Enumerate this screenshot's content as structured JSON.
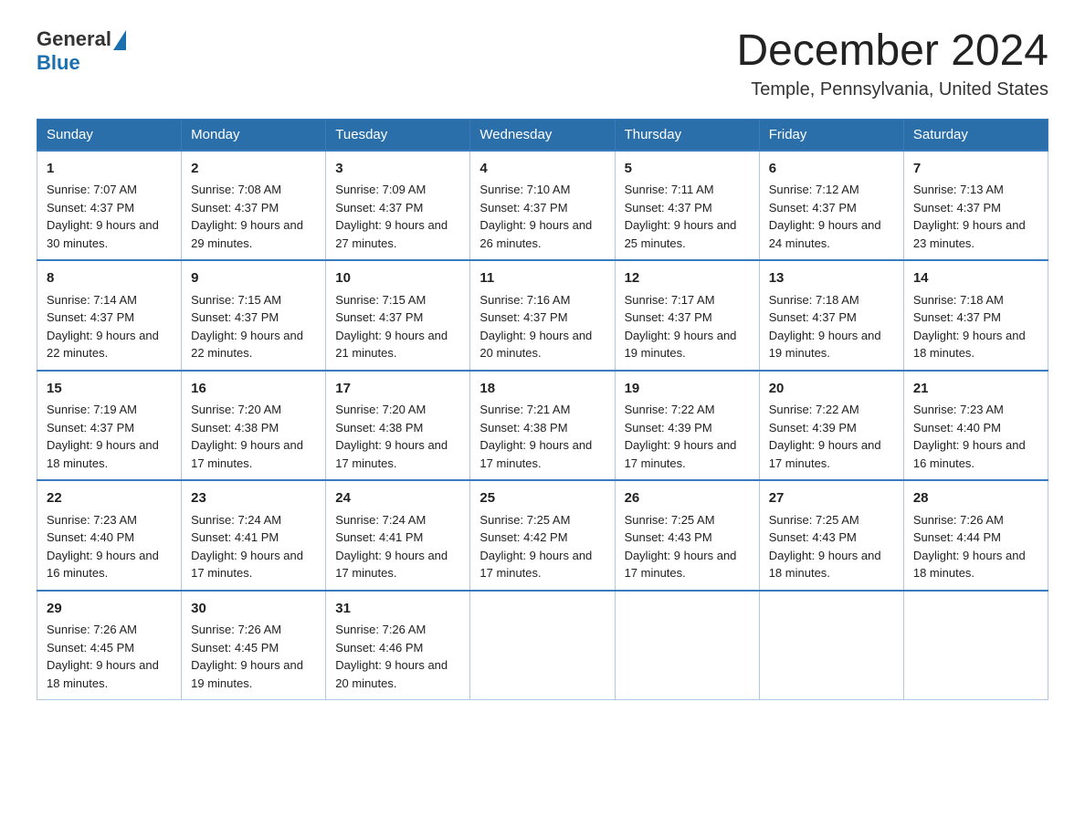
{
  "header": {
    "logo_general": "General",
    "logo_blue": "Blue",
    "month_title": "December 2024",
    "location": "Temple, Pennsylvania, United States"
  },
  "weekdays": [
    "Sunday",
    "Monday",
    "Tuesday",
    "Wednesday",
    "Thursday",
    "Friday",
    "Saturday"
  ],
  "weeks": [
    [
      {
        "day": "1",
        "sunrise": "7:07 AM",
        "sunset": "4:37 PM",
        "daylight": "9 hours and 30 minutes."
      },
      {
        "day": "2",
        "sunrise": "7:08 AM",
        "sunset": "4:37 PM",
        "daylight": "9 hours and 29 minutes."
      },
      {
        "day": "3",
        "sunrise": "7:09 AM",
        "sunset": "4:37 PM",
        "daylight": "9 hours and 27 minutes."
      },
      {
        "day": "4",
        "sunrise": "7:10 AM",
        "sunset": "4:37 PM",
        "daylight": "9 hours and 26 minutes."
      },
      {
        "day": "5",
        "sunrise": "7:11 AM",
        "sunset": "4:37 PM",
        "daylight": "9 hours and 25 minutes."
      },
      {
        "day": "6",
        "sunrise": "7:12 AM",
        "sunset": "4:37 PM",
        "daylight": "9 hours and 24 minutes."
      },
      {
        "day": "7",
        "sunrise": "7:13 AM",
        "sunset": "4:37 PM",
        "daylight": "9 hours and 23 minutes."
      }
    ],
    [
      {
        "day": "8",
        "sunrise": "7:14 AM",
        "sunset": "4:37 PM",
        "daylight": "9 hours and 22 minutes."
      },
      {
        "day": "9",
        "sunrise": "7:15 AM",
        "sunset": "4:37 PM",
        "daylight": "9 hours and 22 minutes."
      },
      {
        "day": "10",
        "sunrise": "7:15 AM",
        "sunset": "4:37 PM",
        "daylight": "9 hours and 21 minutes."
      },
      {
        "day": "11",
        "sunrise": "7:16 AM",
        "sunset": "4:37 PM",
        "daylight": "9 hours and 20 minutes."
      },
      {
        "day": "12",
        "sunrise": "7:17 AM",
        "sunset": "4:37 PM",
        "daylight": "9 hours and 19 minutes."
      },
      {
        "day": "13",
        "sunrise": "7:18 AM",
        "sunset": "4:37 PM",
        "daylight": "9 hours and 19 minutes."
      },
      {
        "day": "14",
        "sunrise": "7:18 AM",
        "sunset": "4:37 PM",
        "daylight": "9 hours and 18 minutes."
      }
    ],
    [
      {
        "day": "15",
        "sunrise": "7:19 AM",
        "sunset": "4:37 PM",
        "daylight": "9 hours and 18 minutes."
      },
      {
        "day": "16",
        "sunrise": "7:20 AM",
        "sunset": "4:38 PM",
        "daylight": "9 hours and 17 minutes."
      },
      {
        "day": "17",
        "sunrise": "7:20 AM",
        "sunset": "4:38 PM",
        "daylight": "9 hours and 17 minutes."
      },
      {
        "day": "18",
        "sunrise": "7:21 AM",
        "sunset": "4:38 PM",
        "daylight": "9 hours and 17 minutes."
      },
      {
        "day": "19",
        "sunrise": "7:22 AM",
        "sunset": "4:39 PM",
        "daylight": "9 hours and 17 minutes."
      },
      {
        "day": "20",
        "sunrise": "7:22 AM",
        "sunset": "4:39 PM",
        "daylight": "9 hours and 17 minutes."
      },
      {
        "day": "21",
        "sunrise": "7:23 AM",
        "sunset": "4:40 PM",
        "daylight": "9 hours and 16 minutes."
      }
    ],
    [
      {
        "day": "22",
        "sunrise": "7:23 AM",
        "sunset": "4:40 PM",
        "daylight": "9 hours and 16 minutes."
      },
      {
        "day": "23",
        "sunrise": "7:24 AM",
        "sunset": "4:41 PM",
        "daylight": "9 hours and 17 minutes."
      },
      {
        "day": "24",
        "sunrise": "7:24 AM",
        "sunset": "4:41 PM",
        "daylight": "9 hours and 17 minutes."
      },
      {
        "day": "25",
        "sunrise": "7:25 AM",
        "sunset": "4:42 PM",
        "daylight": "9 hours and 17 minutes."
      },
      {
        "day": "26",
        "sunrise": "7:25 AM",
        "sunset": "4:43 PM",
        "daylight": "9 hours and 17 minutes."
      },
      {
        "day": "27",
        "sunrise": "7:25 AM",
        "sunset": "4:43 PM",
        "daylight": "9 hours and 18 minutes."
      },
      {
        "day": "28",
        "sunrise": "7:26 AM",
        "sunset": "4:44 PM",
        "daylight": "9 hours and 18 minutes."
      }
    ],
    [
      {
        "day": "29",
        "sunrise": "7:26 AM",
        "sunset": "4:45 PM",
        "daylight": "9 hours and 18 minutes."
      },
      {
        "day": "30",
        "sunrise": "7:26 AM",
        "sunset": "4:45 PM",
        "daylight": "9 hours and 19 minutes."
      },
      {
        "day": "31",
        "sunrise": "7:26 AM",
        "sunset": "4:46 PM",
        "daylight": "9 hours and 20 minutes."
      },
      null,
      null,
      null,
      null
    ]
  ],
  "labels": {
    "sunrise": "Sunrise: ",
    "sunset": "Sunset: ",
    "daylight": "Daylight: "
  }
}
